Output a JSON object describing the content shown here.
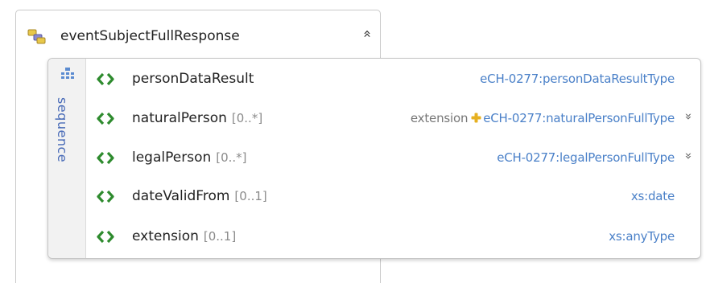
{
  "element": {
    "title": "eventSubjectFullResponse",
    "collapse_glyph": "»",
    "icon": "complex-element-icon"
  },
  "sequence": {
    "label": "sequence",
    "icon": "sequence-icon",
    "children": [
      {
        "name": "personDataResult",
        "multiplicity": "",
        "derivation": "",
        "type": "eCH-0277:personDataResultType",
        "expandable": false
      },
      {
        "name": "naturalPerson",
        "multiplicity": "[0..*]",
        "derivation": "extension",
        "type": "eCH-0277:naturalPersonFullType",
        "expandable": true
      },
      {
        "name": "legalPerson",
        "multiplicity": "[0..*]",
        "derivation": "",
        "type": "eCH-0277:legalPersonFullType",
        "expandable": true
      },
      {
        "name": "dateValidFrom",
        "multiplicity": "[0..1]",
        "derivation": "",
        "type": "xs:date",
        "expandable": false
      },
      {
        "name": "extension",
        "multiplicity": "[0..1]",
        "derivation": "",
        "type": "xs:anyType",
        "expandable": false
      }
    ],
    "expand_glyph": "»"
  },
  "colors": {
    "type_text": "#4a80c8",
    "element_badge_green": "#2e8b2e",
    "multiplicity_gray": "#8b8b8b"
  }
}
